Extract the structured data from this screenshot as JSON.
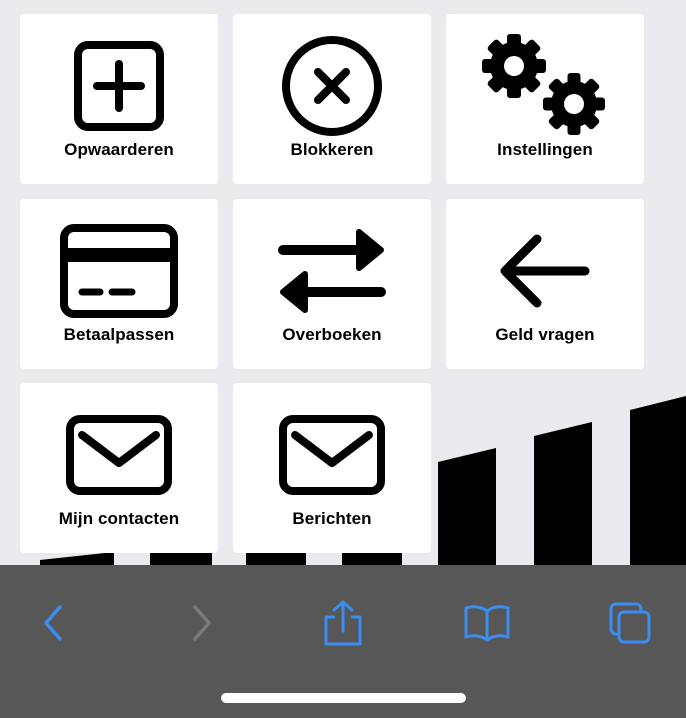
{
  "tiles": [
    {
      "label": "Opwaarderen",
      "icon": "plus-square-icon"
    },
    {
      "label": "Blokkeren",
      "icon": "x-circle-icon"
    },
    {
      "label": "Instellingen",
      "icon": "gears-icon"
    },
    {
      "label": "Betaalpassen",
      "icon": "credit-card-icon"
    },
    {
      "label": "Overboeken",
      "icon": "transfer-arrows-icon"
    },
    {
      "label": "Geld vragen",
      "icon": "arrow-left-icon"
    },
    {
      "label": "Mijn contacten",
      "icon": "envelope-icon"
    },
    {
      "label": "Berichten",
      "icon": "envelope-icon"
    }
  ],
  "toolbar": {
    "back": "chevron-left-icon",
    "forward": "chevron-right-icon",
    "share": "share-icon",
    "bookmarks": "book-icon",
    "tabs": "tabs-icon"
  },
  "colors": {
    "background": "#e9ebee",
    "tile": "#ffffff",
    "toolbar": "#575757",
    "accent": "#3b8ef0",
    "disabled": "#7a7a7a"
  }
}
